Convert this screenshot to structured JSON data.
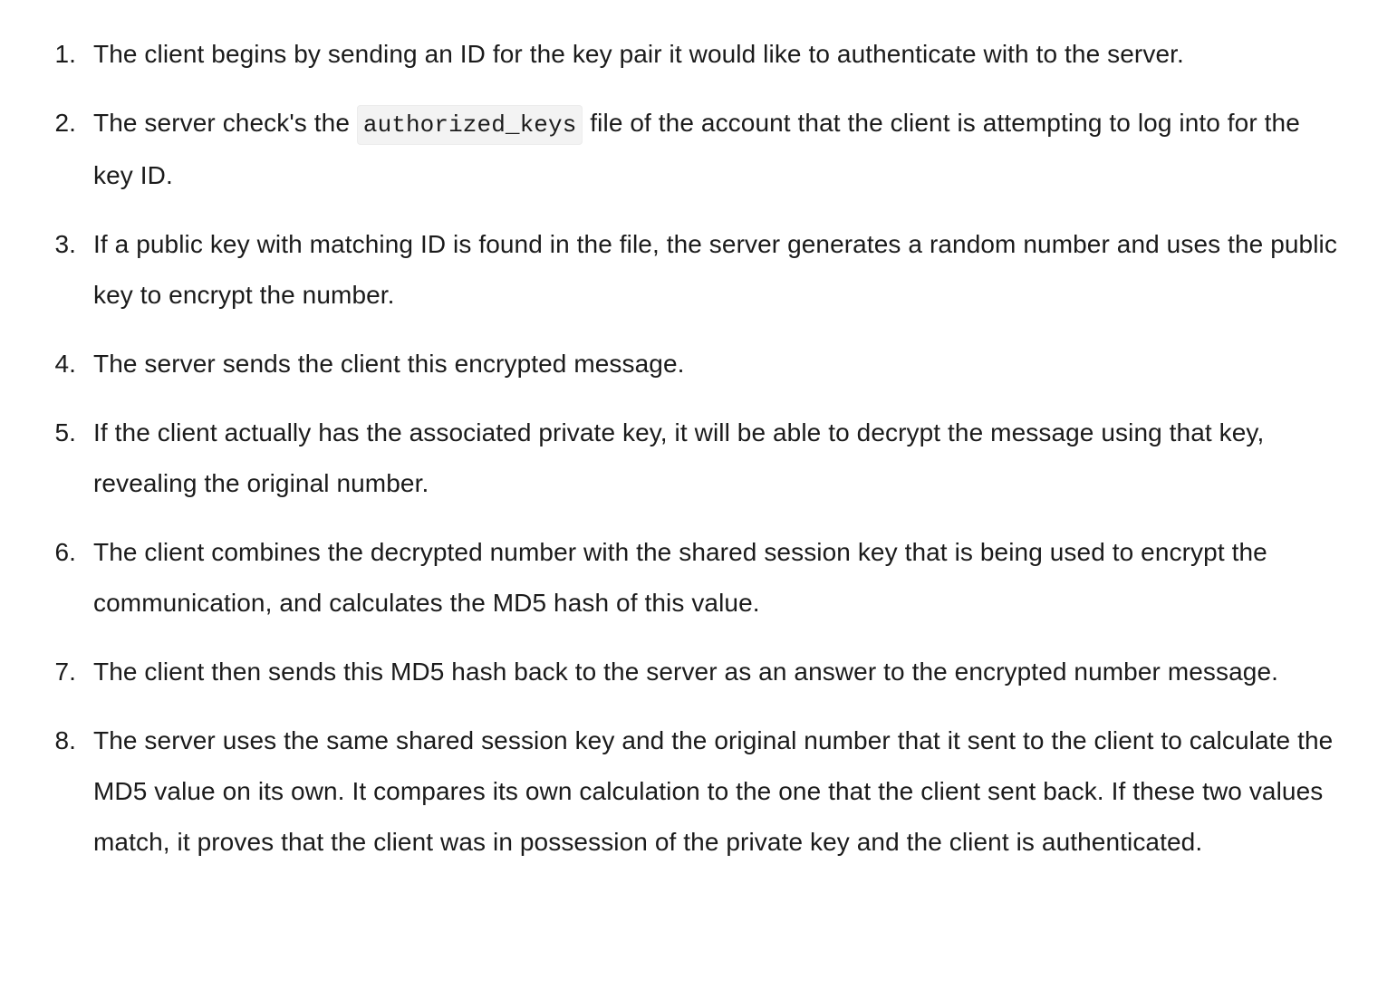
{
  "steps": [
    {
      "number": "1.",
      "text": "The client begins by sending an ID for the key pair it would like to authenticate with to the server."
    },
    {
      "number": "2.",
      "before": "The server check's the ",
      "code": "authorized_keys",
      "after": " file of the account that the client is attempting to log into for the key ID."
    },
    {
      "number": "3.",
      "text": "If a public key with matching ID is found in the file, the server generates a random number and uses the public key to encrypt the number."
    },
    {
      "number": "4.",
      "text": "The server sends the client this encrypted message."
    },
    {
      "number": "5.",
      "text": "If the client actually has the associated private key, it will be able to decrypt the message using that key, revealing the original number."
    },
    {
      "number": "6.",
      "text": "The client combines the decrypted number with the shared session key that is being used to encrypt the communication, and calculates the MD5 hash of this value."
    },
    {
      "number": "7.",
      "text": "The client then sends this MD5 hash back to the server as an answer to the encrypted number message."
    },
    {
      "number": "8.",
      "text": "The server uses the same shared session key and the original number that it sent to the client to calculate the MD5 value on its own. It compares its own calculation to the one that the client sent back. If these two values match, it proves that the client was in possession of the private key and the client is authenticated."
    }
  ]
}
